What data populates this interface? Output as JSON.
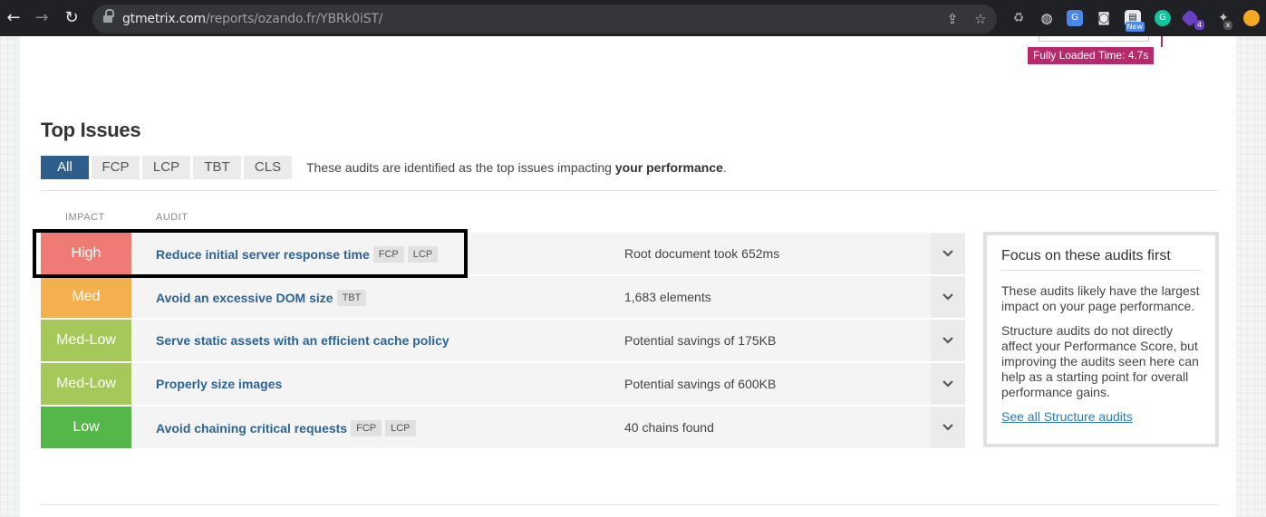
{
  "browser": {
    "url_host": "gtmetrix.com",
    "url_path": "/reports/ozando.fr/YBRk0iST/",
    "ext_new_badge": "New",
    "ext_count_badge": "4",
    "ext_x_badge": "x"
  },
  "fully_loaded": "Fully Loaded Time: 4.7s",
  "section": {
    "title": "Top Issues",
    "tabs": [
      "All",
      "FCP",
      "LCP",
      "TBT",
      "CLS"
    ],
    "active_tab": "All",
    "desc_prefix": "These audits are identified as the top issues impacting ",
    "desc_bold": "your performance",
    "desc_suffix": "."
  },
  "columns": {
    "impact": "IMPACT",
    "audit": "AUDIT"
  },
  "rows": [
    {
      "impact": "High",
      "color": "#ee7c74",
      "audit": "Reduce initial server response time",
      "metrics": [
        "FCP",
        "LCP"
      ],
      "result": "Root document took 652ms"
    },
    {
      "impact": "Med",
      "color": "#f4b04f",
      "audit": "Avoid an excessive DOM size",
      "metrics": [
        "TBT"
      ],
      "result": "1,683 elements"
    },
    {
      "impact": "Med-Low",
      "color": "#a4c95a",
      "audit": "Serve static assets with an efficient cache policy",
      "metrics": [],
      "result": "Potential savings of 175KB"
    },
    {
      "impact": "Med-Low",
      "color": "#a4c95a",
      "audit": "Properly size images",
      "metrics": [],
      "result": "Potential savings of 600KB"
    },
    {
      "impact": "Low",
      "color": "#54b749",
      "audit": "Avoid chaining critical requests",
      "metrics": [
        "FCP",
        "LCP"
      ],
      "result": "40 chains found"
    }
  ],
  "side": {
    "title": "Focus on these audits first",
    "p1": "These audits likely have the largest impact on your page performance.",
    "p2": "Structure audits do not directly affect your Performance Score, but improving the audits seen here can help as a starting point for overall performance gains.",
    "link": "See all Structure audits"
  }
}
